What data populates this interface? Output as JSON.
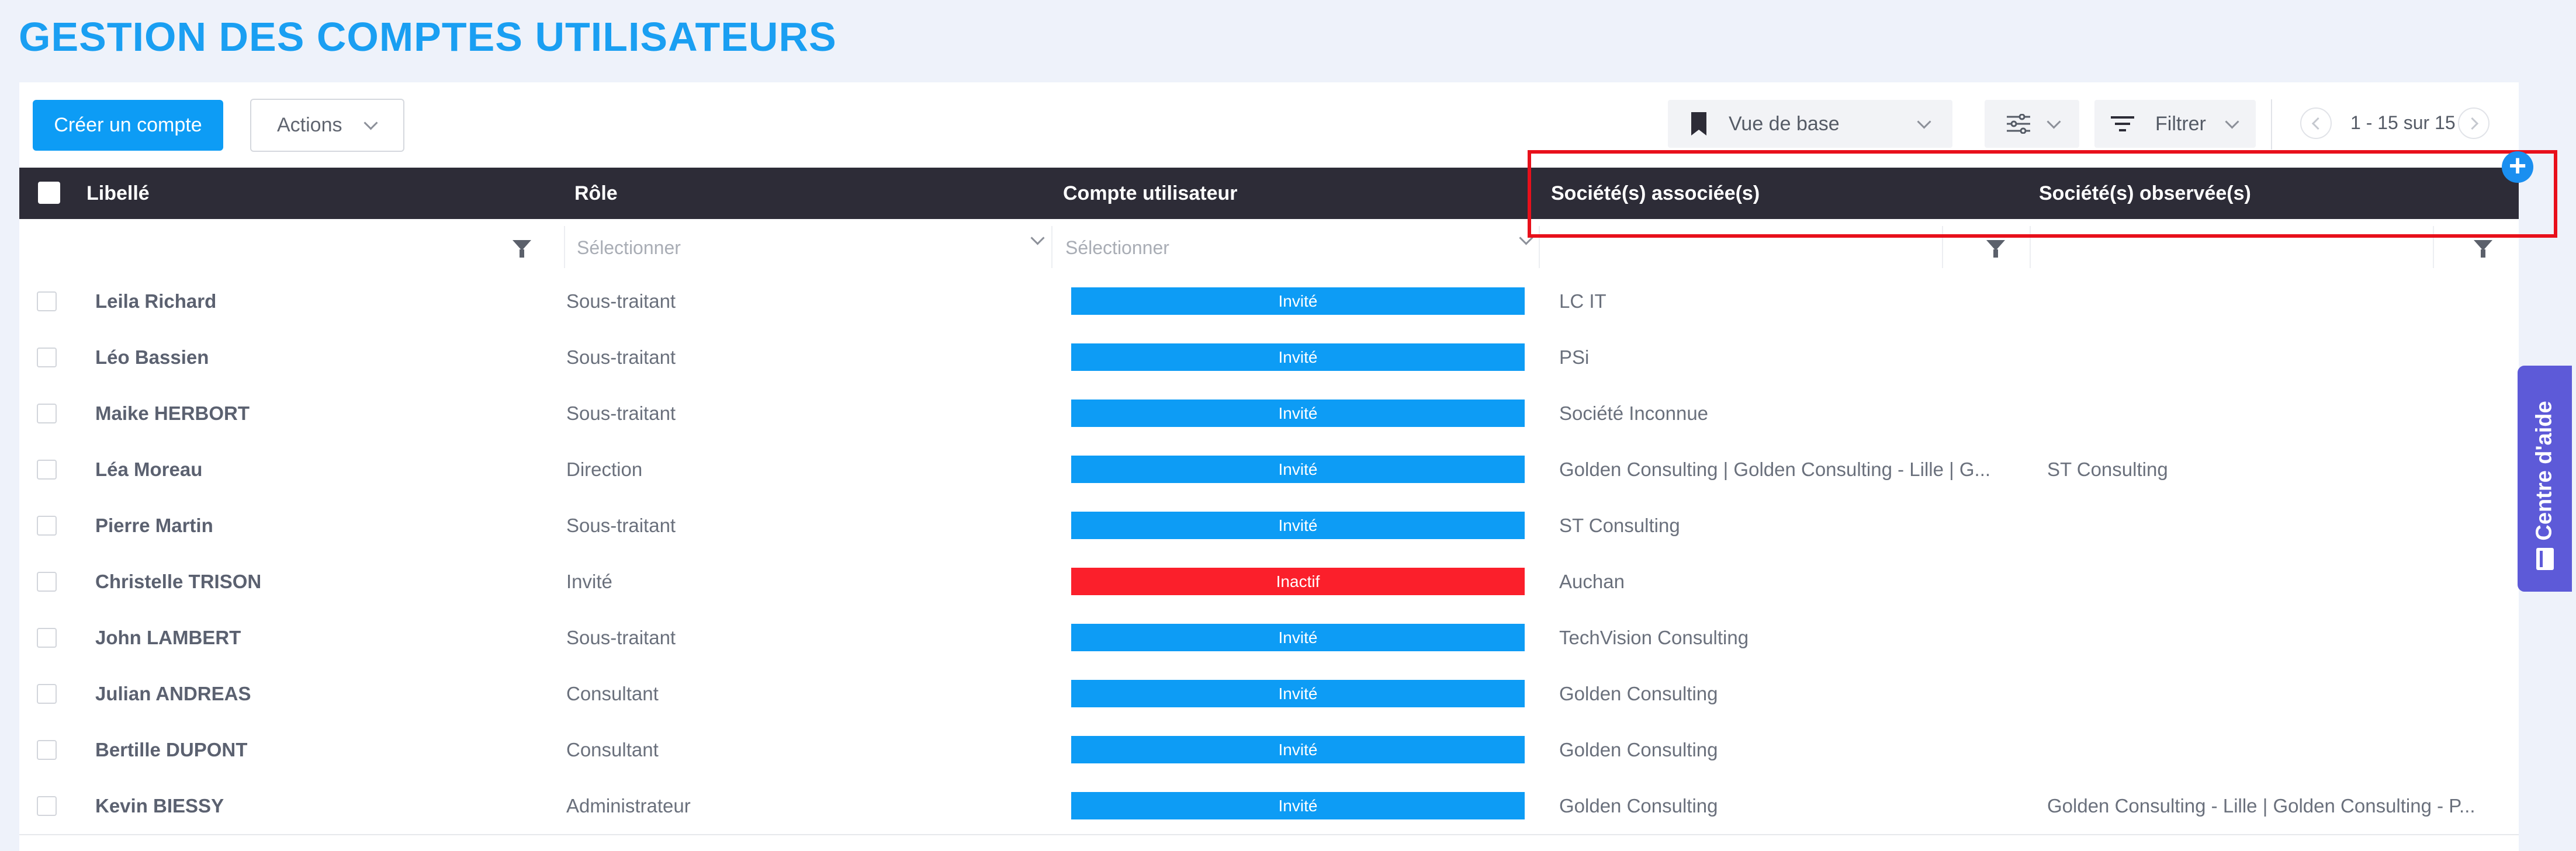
{
  "page": {
    "title": "GESTION DES COMPTES UTILISATEURS"
  },
  "toolbar": {
    "create_label": "Créer un compte",
    "actions_label": "Actions",
    "view_label": "Vue de base",
    "filter_label": "Filtrer",
    "pagination": "1 - 15 sur 15"
  },
  "table": {
    "headers": {
      "libelle": "Libellé",
      "role": "Rôle",
      "compte": "Compte utilisateur",
      "associees": "Société(s) associée(s)",
      "observees": "Société(s) observée(s)"
    },
    "filters": {
      "role_placeholder": "Sélectionner",
      "compte_placeholder": "Sélectionner"
    },
    "rows": [
      {
        "name": "Leila Richard",
        "role": "Sous-traitant",
        "status": "Invité",
        "associees": "LC IT",
        "observees": ""
      },
      {
        "name": "Léo Bassien",
        "role": "Sous-traitant",
        "status": "Invité",
        "associees": "PSi",
        "observees": ""
      },
      {
        "name": "Maike HERBORT",
        "role": "Sous-traitant",
        "status": "Invité",
        "associees": "Société Inconnue",
        "observees": ""
      },
      {
        "name": "Léa Moreau",
        "role": "Direction",
        "status": "Invité",
        "associees": "Golden Consulting | Golden Consulting - Lille | G...",
        "observees": "ST Consulting"
      },
      {
        "name": "Pierre Martin",
        "role": "Sous-traitant",
        "status": "Invité",
        "associees": "ST Consulting",
        "observees": ""
      },
      {
        "name": "Christelle TRISON",
        "role": "Invité",
        "status": "Inactif",
        "associees": "Auchan",
        "observees": ""
      },
      {
        "name": "John LAMBERT",
        "role": "Sous-traitant",
        "status": "Invité",
        "associees": "TechVision Consulting",
        "observees": ""
      },
      {
        "name": "Julian ANDREAS",
        "role": "Consultant",
        "status": "Invité",
        "associees": "Golden Consulting",
        "observees": ""
      },
      {
        "name": "Bertille DUPONT",
        "role": "Consultant",
        "status": "Invité",
        "associees": "Golden Consulting",
        "observees": ""
      },
      {
        "name": "Kevin BIESSY",
        "role": "Administrateur",
        "status": "Invité",
        "associees": "Golden Consulting",
        "observees": "Golden Consulting - Lille | Golden Consulting - P..."
      }
    ]
  },
  "colors": {
    "invite": "#0d9cf5",
    "inactif": "#fb1f2b",
    "accent": "#1a9ff2",
    "help": "#5d5ad8"
  },
  "help": {
    "label": "Centre d'aide"
  }
}
